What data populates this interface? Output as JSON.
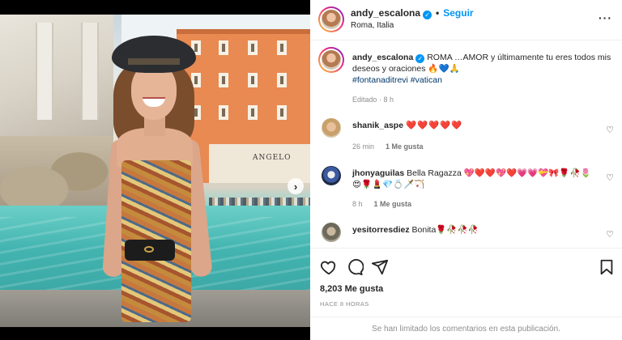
{
  "post": {
    "photo_alt": "",
    "carousel_next_glyph": "›"
  },
  "header": {
    "username": "andy_escalona",
    "verified_glyph": "✓",
    "separator": "•",
    "follow_label": "Seguir",
    "location": "Roma, Italia",
    "more_glyph": "···"
  },
  "caption": {
    "username": "andy_escalona",
    "text": " ROMA …AMOR y últimamente tu eres todos mis deseos y oraciones 🔥💙🙏",
    "hashtags": "#fontanaditrevi #vatican",
    "edited": "Editado · 8 h"
  },
  "comments": [
    {
      "username": "shanik_aspe",
      "text": "❤️❤️❤️❤️❤️",
      "time": "26 min",
      "likes": "1 Me gusta"
    },
    {
      "username": "jhonyaguilas",
      "text": "Bella Ragazza 💖❤️❤️💖❤️💗💗💝🎀🌹🥀🌷😍🌹💄💎💍🗡️🏹",
      "time": "8 h",
      "likes": "1 Me gusta"
    },
    {
      "username": "yesitorresdiez",
      "text": "Bonita🌹🥀🥀🥀",
      "time": "",
      "likes": ""
    }
  ],
  "actions": {
    "likes": "8,203 Me gusta",
    "when": "HACE 8 HORAS",
    "limited": "Se han limitado los comentarios en esta publicación."
  },
  "photo_sign": "ANGELO",
  "icons": {
    "like": "heart-outline-icon",
    "comment": "comment-bubble-icon",
    "share": "paper-plane-icon",
    "save": "bookmark-icon"
  },
  "colors": {
    "link_blue": "#0095f6",
    "hashtag": "#00376b",
    "meta_gray": "#8e8e8e"
  }
}
